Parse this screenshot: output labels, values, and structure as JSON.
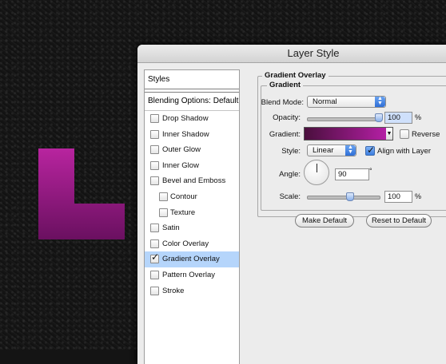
{
  "dialog": {
    "title": "Layer Style"
  },
  "styles_panel": {
    "header_styles": "Styles",
    "header_blending": "Blending Options: Default",
    "items": [
      {
        "label": "Drop Shadow",
        "checked": false,
        "sub": false,
        "selected": false
      },
      {
        "label": "Inner Shadow",
        "checked": false,
        "sub": false,
        "selected": false
      },
      {
        "label": "Outer Glow",
        "checked": false,
        "sub": false,
        "selected": false
      },
      {
        "label": "Inner Glow",
        "checked": false,
        "sub": false,
        "selected": false
      },
      {
        "label": "Bevel and Emboss",
        "checked": false,
        "sub": false,
        "selected": false
      },
      {
        "label": "Contour",
        "checked": false,
        "sub": true,
        "selected": false
      },
      {
        "label": "Texture",
        "checked": false,
        "sub": true,
        "selected": false
      },
      {
        "label": "Satin",
        "checked": false,
        "sub": false,
        "selected": false
      },
      {
        "label": "Color Overlay",
        "checked": false,
        "sub": false,
        "selected": false
      },
      {
        "label": "Gradient Overlay",
        "checked": true,
        "sub": false,
        "selected": true
      },
      {
        "label": "Pattern Overlay",
        "checked": false,
        "sub": false,
        "selected": false
      },
      {
        "label": "Stroke",
        "checked": false,
        "sub": false,
        "selected": false
      }
    ]
  },
  "gradient_overlay": {
    "group_title": "Gradient Overlay",
    "subgroup_title": "Gradient",
    "blend_mode_label": "Blend Mode:",
    "blend_mode_value": "Normal",
    "opacity_label": "Opacity:",
    "opacity_value": "100",
    "opacity_fraction": 1.0,
    "percent": "%",
    "gradient_label": "Gradient:",
    "gradient_start_color": "#4a0f3d",
    "gradient_end_color": "#b41fa4",
    "reverse_label": "Reverse",
    "reverse_checked": false,
    "style_label": "Style:",
    "style_value": "Linear",
    "align_label": "Align with Layer",
    "align_checked": true,
    "angle_label": "Angle:",
    "angle_value": "90",
    "degree": "°",
    "scale_label": "Scale:",
    "scale_value": "100",
    "scale_fraction": 0.6
  },
  "buttons": {
    "make_default": "Make Default",
    "reset_default": "Reset to Default"
  },
  "canvas": {
    "letter_top_color": "#b8249f",
    "letter_bottom_color": "#6a1060"
  }
}
